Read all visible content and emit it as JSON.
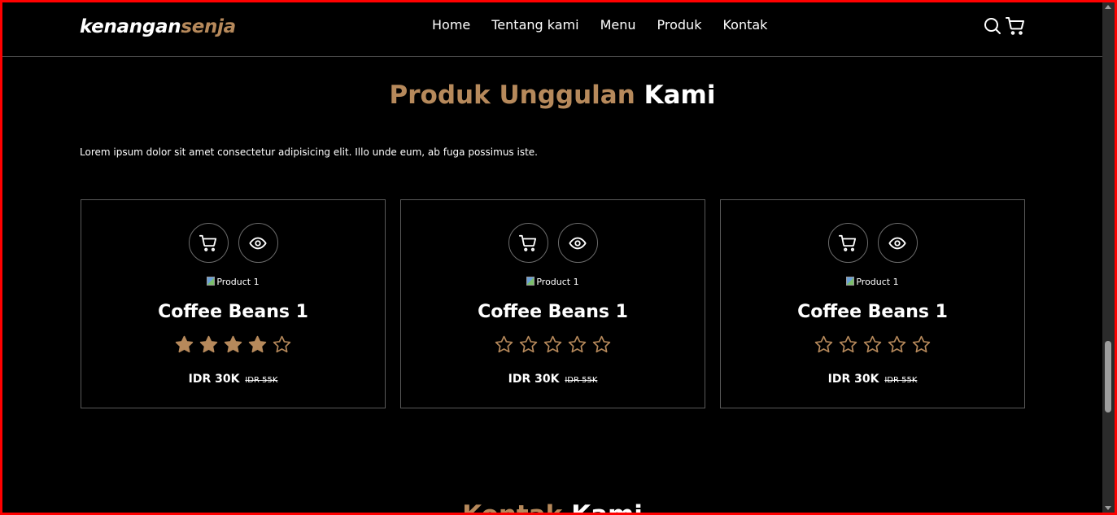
{
  "brand": {
    "part1": "kenangan",
    "part2": "senja"
  },
  "nav": {
    "links": [
      "Home",
      "Tentang kami",
      "Menu",
      "Produk",
      "Kontak"
    ],
    "icons": [
      "search-icon",
      "shopping-cart-icon"
    ]
  },
  "products_section": {
    "title_highlight": "Produk Unggulan",
    "title_rest": "Kami",
    "description": "Lorem ipsum dolor sit amet consectetur adipisicing elit. Illo unde eum, ab fuga possimus iste.",
    "cards": [
      {
        "image_alt": "Product 1",
        "name": "Coffee Beans 1",
        "rating": 4,
        "max_rating": 5,
        "price": "IDR 30K",
        "old_price": "IDR 55K"
      },
      {
        "image_alt": "Product 1",
        "name": "Coffee Beans 1",
        "rating": 0,
        "max_rating": 5,
        "price": "IDR 30K",
        "old_price": "IDR 55K"
      },
      {
        "image_alt": "Product 1",
        "name": "Coffee Beans 1",
        "rating": 0,
        "max_rating": 5,
        "price": "IDR 30K",
        "old_price": "IDR 55K"
      }
    ]
  },
  "next_section": {
    "title_highlight": "Kontak",
    "title_rest": "Kami"
  },
  "colors": {
    "accent": "#b6895b",
    "background": "#000000",
    "text": "#ffffff",
    "border": "#5a5a5a"
  }
}
